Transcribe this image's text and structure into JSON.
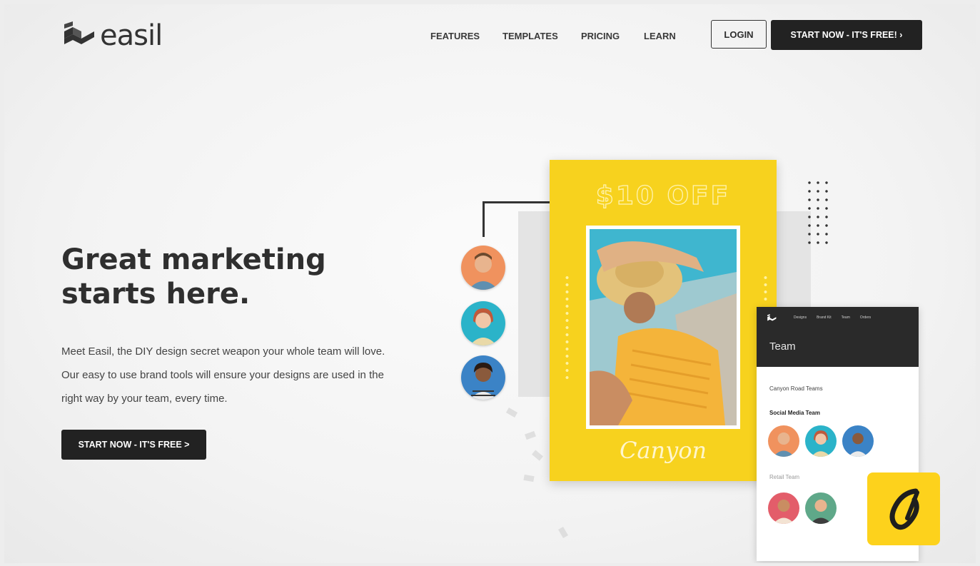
{
  "brand": {
    "name": "easil"
  },
  "nav": {
    "items": [
      "FEATURES",
      "TEMPLATES",
      "PRICING",
      "LEARN"
    ],
    "login_label": "LOGIN",
    "start_label": "START NOW - IT'S FREE! ›"
  },
  "hero": {
    "headline_line1": "Great marketing",
    "headline_line2": "starts here.",
    "description": "Meet Easil, the DIY design secret weapon your whole team will love. Our easy to use brand tools will ensure your designs are used in the right way by your team, every time.",
    "cta_label": "START NOW - IT'S FREE >"
  },
  "illustration": {
    "poster_title": "$10 OFF",
    "poster_script": "Canyon",
    "panel": {
      "nav_items": [
        "Designs",
        "Brand Kit",
        "Team",
        "Orders"
      ],
      "title": "Team",
      "group_label": "Canyon Road Teams",
      "team1_label": "Social Media Team",
      "team2_label": "Retail Team"
    }
  },
  "colors": {
    "accent_yellow": "#f7d21e",
    "dark": "#222222",
    "badge_yellow": "#fdd21c"
  },
  "icons": [
    "easil-logo-icon",
    "brand-badge-icon"
  ]
}
